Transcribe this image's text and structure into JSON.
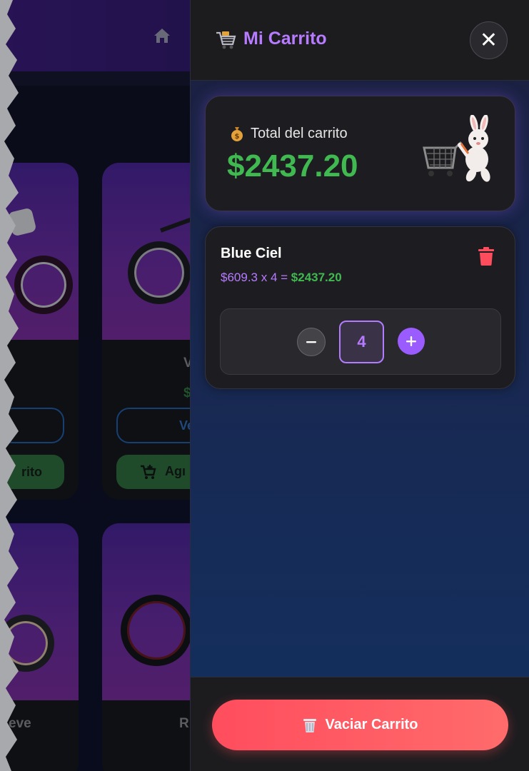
{
  "background": {
    "cards": [
      {
        "name_fragment": "",
        "button_outline_fragment": "",
        "button_green_fragment": "rito"
      },
      {
        "name_fragment": "V",
        "price_fragment": "$",
        "button_outline_fragment": "Ve",
        "button_green_fragment": "Agı"
      },
      {
        "name_fragment": "eve"
      },
      {
        "name_fragment": "R"
      }
    ]
  },
  "drawer": {
    "title": "Mi Carrito",
    "icons": {
      "cart": "shopping-cart-icon",
      "close": "close-icon"
    },
    "total": {
      "label": "Total del carrito",
      "value": "$2437.20"
    },
    "items": [
      {
        "name": "Blue Ciel",
        "unit_expr": "$609.3 x 4 = ",
        "line_total": "$2437.20",
        "quantity": "4"
      }
    ],
    "clear_label": "Vaciar Carrito"
  },
  "colors": {
    "accent_purple": "#b77bff",
    "total_green": "#3fb950",
    "danger_red": "#ff4d5e"
  }
}
